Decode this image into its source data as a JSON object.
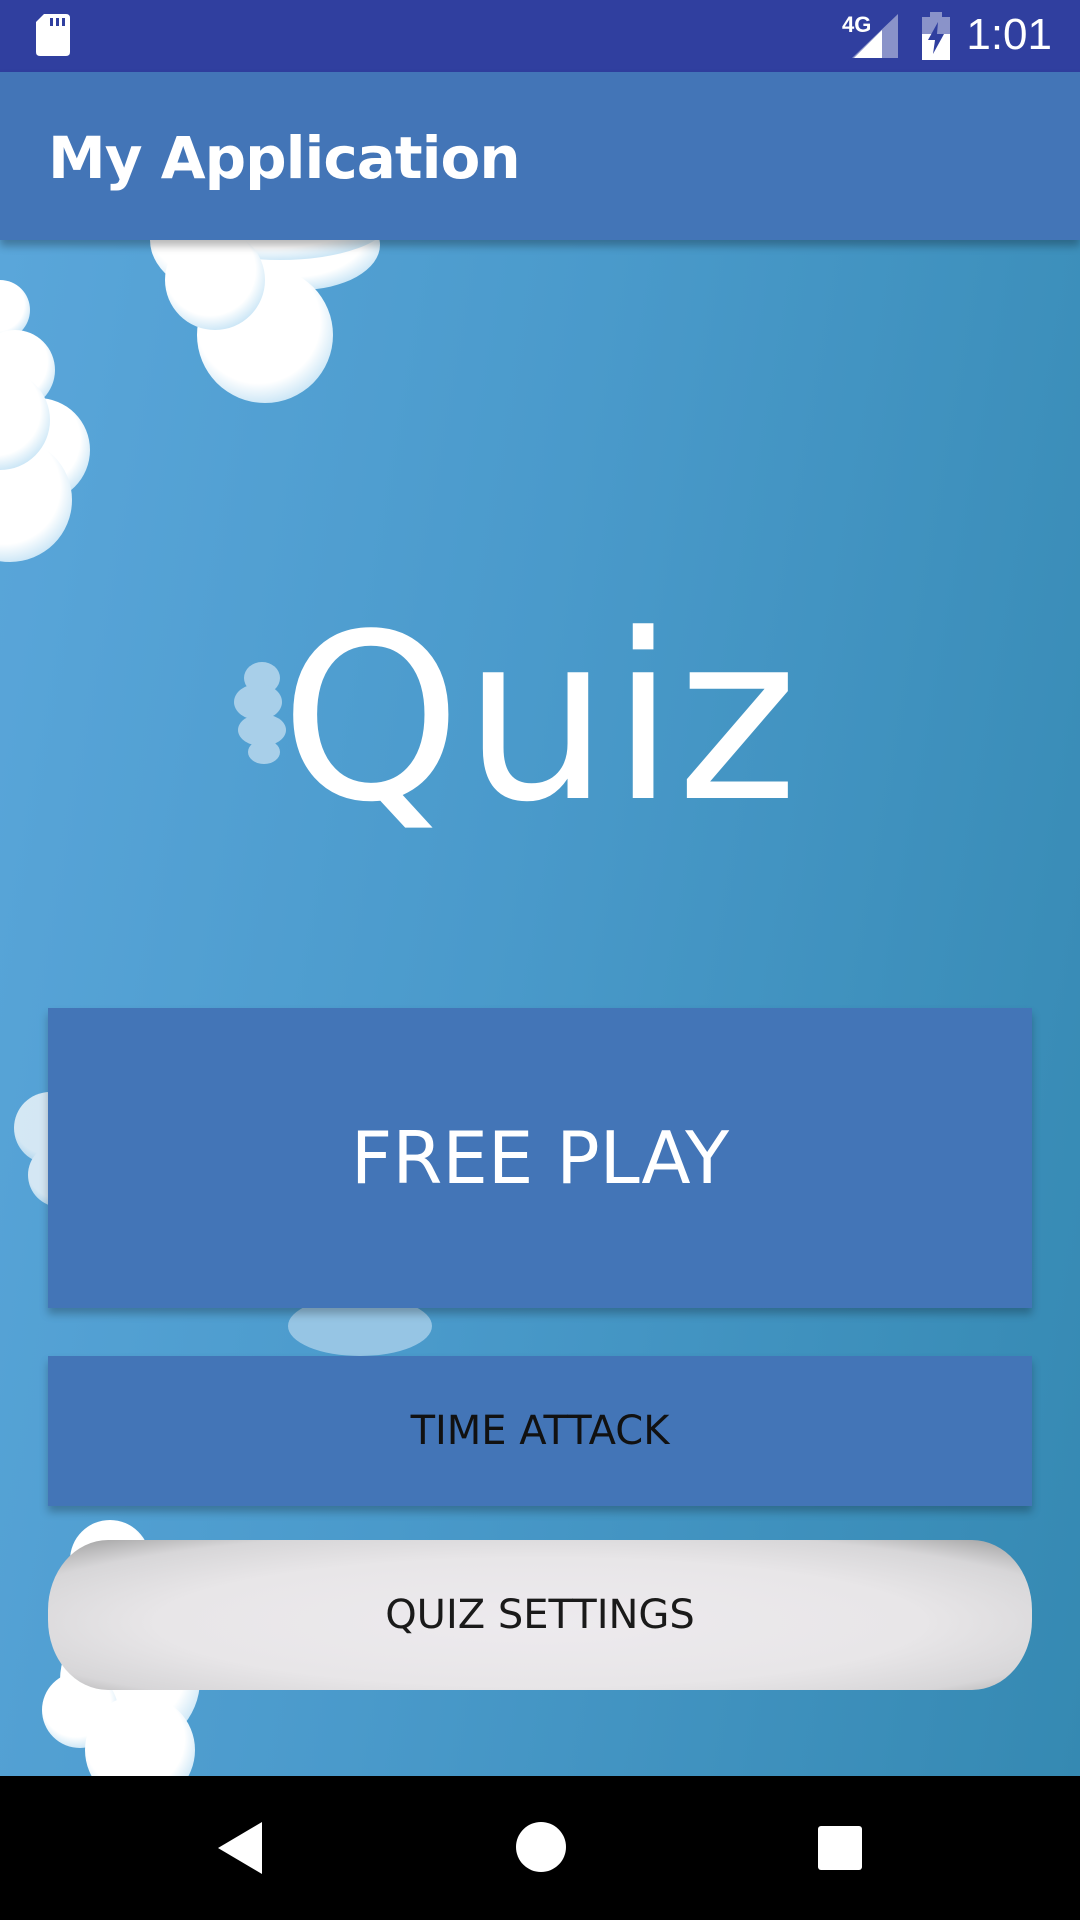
{
  "status_bar": {
    "network_label": "4G",
    "time": "1:01",
    "icons": [
      "sd-card-icon",
      "signal-icon",
      "battery-charging-icon"
    ]
  },
  "app_bar": {
    "title": "My Application"
  },
  "main": {
    "quiz_title": "Quiz",
    "buttons": {
      "free_play": "FREE PLAY",
      "time_attack": "TIME ATTACK",
      "quiz_settings": "QUIZ SETTINGS"
    }
  },
  "nav_bar": {
    "icons": [
      "back-icon",
      "home-icon",
      "recents-icon"
    ]
  },
  "colors": {
    "status_bar": "#303F9F",
    "primary": "#4375B7",
    "background_start": "#5AA6DA",
    "background_end": "#3589B2",
    "settings_button": "#E8E6E8"
  }
}
